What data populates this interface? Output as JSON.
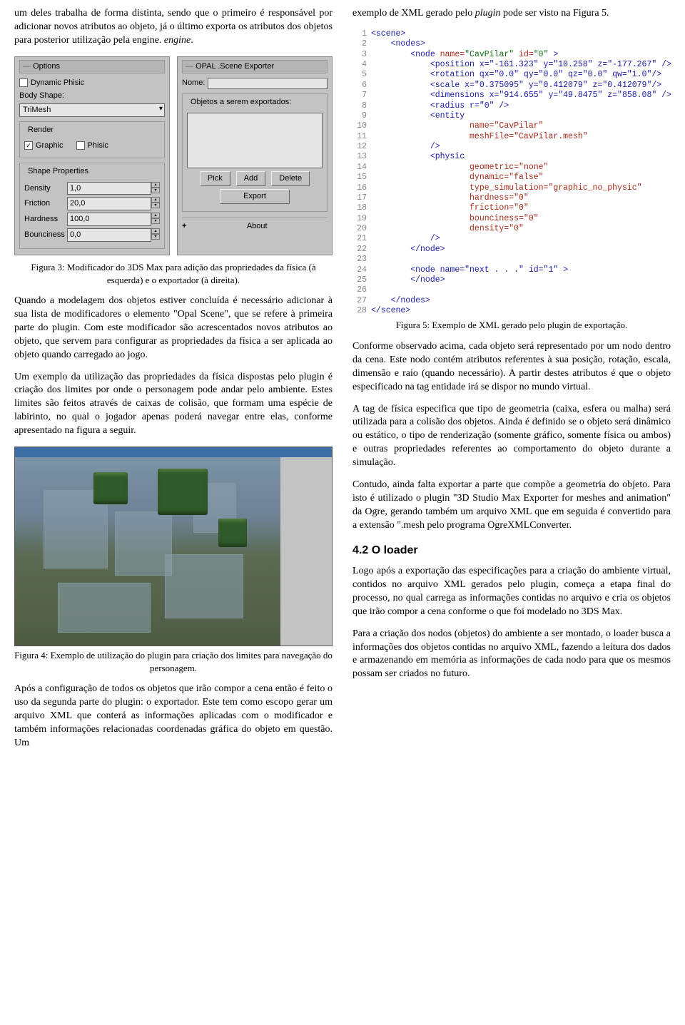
{
  "col_left": {
    "p1": "um deles trabalha de forma distinta, sendo que o primeiro é responsável por adicionar novos atributos ao objeto, já o último exporta os atributos dos objetos para posterior utilização pela engine.",
    "caption_fig3": "Figura 3: Modificador do 3DS Max para adição das propriedades da física (à esquerda) e o exportador (à direita).",
    "p2": "Quando a modelagem dos objetos estiver concluída é necessário adicionar à sua lista de modificadores o elemento \"Opal Scene\", que se refere à primeira parte do plugin. Com este modificador são acrescentados novos atributos ao objeto, que servem para configurar as propriedades da física a ser aplicada ao objeto quando carregado ao jogo.",
    "p3": "Um exemplo da utilização das propriedades da física dispostas pelo plugin é criação dos limites por onde o personagem pode andar pelo ambiente. Estes limites são feitos através de caixas de colisão, que formam uma espécie de labirinto, no qual o jogador apenas poderá navegar entre elas, conforme apresentado na figura a seguir.",
    "caption_fig4": "Figura 4: Exemplo de utilização do plugin para criação dos limites para navegação do personagem.",
    "p4": "Após a configuração de todos os objetos que irão compor a cena então é feito o uso da segunda parte do plugin: o exportador. Este tem como escopo gerar um arquivo XML que conterá as informações aplicadas com o modificador e também informações relacionadas coordenadas gráfica do objeto em questão. Um"
  },
  "panel_options": {
    "title": "Options",
    "dyn_phisic": "Dynamic Phisic",
    "body_shape_label": "Body Shape:",
    "body_shape_value": "TriMesh",
    "render_title": "Render",
    "chk_graphic": "Graphic",
    "chk_phisic": "Phisic",
    "shape_title": "Shape Properties",
    "density_label": "Density",
    "density_value": "1,0",
    "friction_label": "Friction",
    "friction_value": "20,0",
    "hardness_label": "Hardness",
    "hardness_value": "100,0",
    "bounciness_label": "Bounciness",
    "bounciness_value": "0,0"
  },
  "panel_export": {
    "title": "OPAL .Scene Exporter",
    "nome_label": "Nome:",
    "objetos_label": "Objetos a serem exportados:",
    "btn_pick": "Pick",
    "btn_add": "Add",
    "btn_delete": "Delete",
    "btn_export": "Export",
    "about": "About"
  },
  "col_right": {
    "p1a": "exemplo de XML gerado pelo ",
    "p1b": " pode ser visto na Figura 5.",
    "plugin_word": "plugin",
    "caption_fig5": "Figura 5: Exemplo de XML gerado pelo plugin de exportação.",
    "p2": "Conforme observado acima, cada objeto será representado por um nodo dentro da cena. Este nodo contém atributos referentes à sua posição, rotação, escala, dimensão e raio (quando necessário). A partir destes atributos é que o objeto especificado na tag entidade irá se dispor no mundo virtual.",
    "p3": "A tag de física especifica que tipo de geometria (caixa, esfera ou malha) será utilizada para a colisão dos objetos. Ainda é definido se o objeto será dinâmico ou estático, o tipo de renderização (somente gráfico, somente física ou ambos) e outras propriedades referentes ao comportamento do objeto durante a simulação.",
    "p4": "Contudo, ainda falta exportar a parte que compõe a geometria do objeto. Para isto é utilizado o plugin \"3D Studio Max Exporter for meshes and animation\" da Ogre, gerando também um arquivo XML que em seguida é convertido para a extensão \".mesh pelo programa OgreXMLConverter.",
    "heading": "4.2 O loader",
    "p5": "Logo após a exportação das especificações para a criação do ambiente virtual, contidos no arquivo XML gerados pelo plugin, começa a etapa final do processo, no qual carrega as informações contidas no arquivo e cria os objetos que irão compor a cena conforme o que foi modelado no 3DS Max.",
    "p6": "Para a criação dos nodos (objetos) do ambiente a ser montado, o loader busca a informações dos objetos contidas no arquivo XML, fazendo a leitura dos dados e armazenando em memória as informações de cada nodo para que os mesmos possam ser criados no futuro."
  },
  "xml": {
    "l1": "<scene>",
    "l2": "    <nodes>",
    "l3a": "        <node ",
    "l3_name": "name=",
    "l3_name_v": "\"CavPilar\"",
    "l3_id": " id=",
    "l3_id_v": "\"0\"",
    "l3b": " >",
    "l4": "            <position x=\"-161.323\" y=\"10.258\" z=\"-177.267\" />",
    "l5": "            <rotation qx=\"0.0\" qy=\"0.0\" qz=\"0.0\" qw=\"1.0\"/>",
    "l6": "            <scale x=\"0.375095\" y=\"0.412079\" z=\"0.412079\"/>",
    "l7": "            <dimensions x=\"914.655\" y=\"49.8475\" z=\"858.08\" />",
    "l8": "            <radius r=\"0\" />",
    "l9": "            <entity",
    "l10": "                    name=\"CavPilar\"",
    "l11": "                    meshFile=\"CavPilar.mesh\"",
    "l12": "            />",
    "l13": "            <physic",
    "l14": "                    geometric=\"none\"",
    "l15": "                    dynamic=\"false\"",
    "l16": "                    type_simulation=\"graphic_no_physic\"",
    "l17": "                    hardness=\"0\"",
    "l18": "                    friction=\"0\"",
    "l19": "                    bounciness=\"0\"",
    "l20": "                    density=\"0\"",
    "l21": "            />",
    "l22": "        </node>",
    "l23": "",
    "l24": "        <node name=\"next . . .\" id=\"1\" >",
    "l25": "        </node>",
    "l26": "",
    "l27": "    </nodes>",
    "l28": "</scene>"
  },
  "chart_data": {
    "type": "table",
    "title": "Shape Properties (3DS Max modifier panel)",
    "categories": [
      "Density",
      "Friction",
      "Hardness",
      "Bounciness"
    ],
    "values": [
      1.0,
      20.0,
      100.0,
      0.0
    ]
  }
}
